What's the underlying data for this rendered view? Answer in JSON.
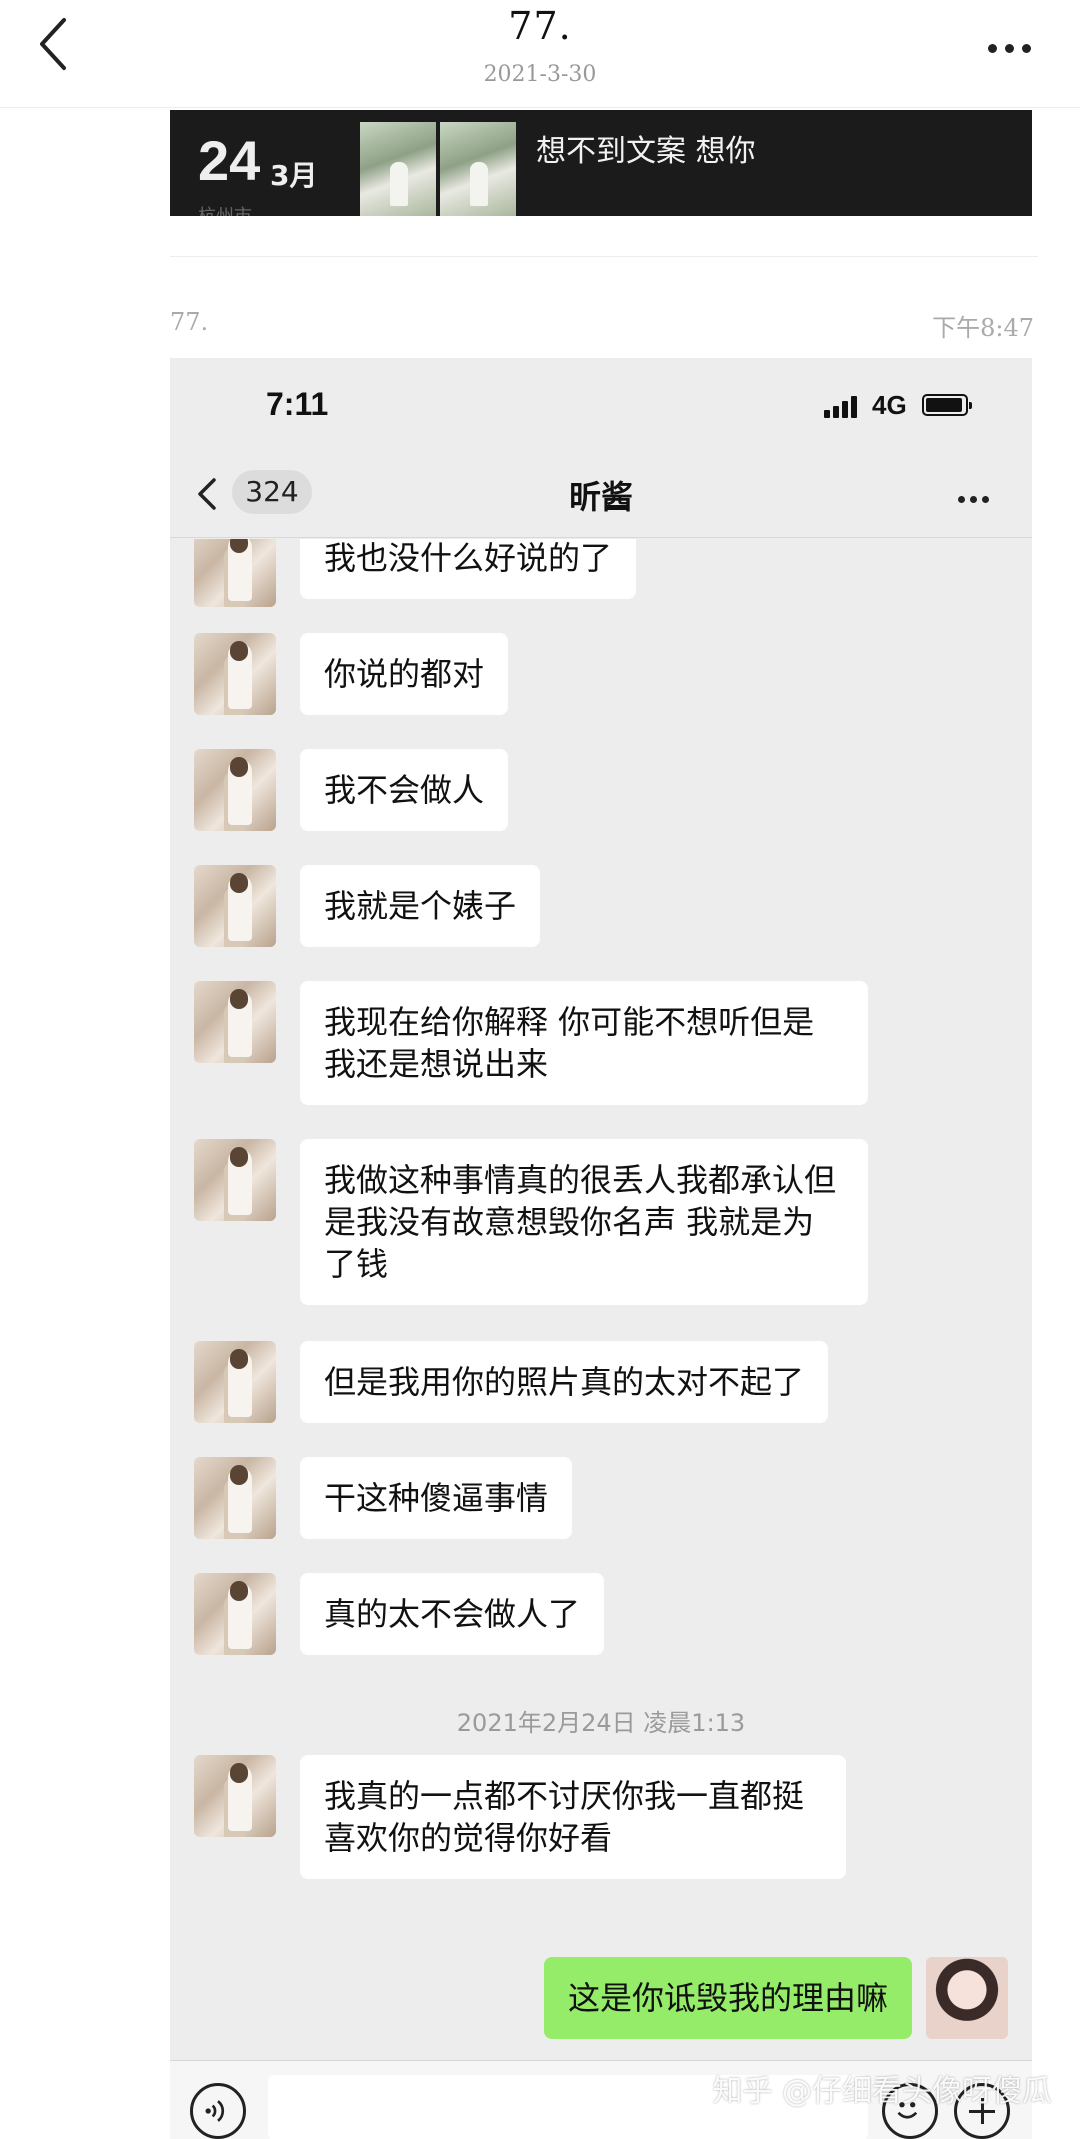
{
  "post": {
    "title": "77.",
    "date": "2021-3-30",
    "author": "77.",
    "time": "下午8:47"
  },
  "banner": {
    "day": "24",
    "month": "3月",
    "city": "杭州市",
    "text": "想不到文案 想你"
  },
  "chat_screenshot": {
    "status_time": "7:11",
    "network": "4G",
    "unread_count": "324",
    "contact_name": "昕酱",
    "messages": [
      {
        "text": "我也没什么好说的了"
      },
      {
        "text": "你说的都对"
      },
      {
        "text": "我不会做人"
      },
      {
        "text": "我就是个婊子"
      },
      {
        "text": "我现在给你解释 你可能不想听但是我还是想说出来"
      },
      {
        "text": "我做这种事情真的很丢人我都承认但是我没有故意想毁你名声 我就是为了钱"
      },
      {
        "text": "但是我用你的照片真的太对不起了"
      },
      {
        "text": "干这种傻逼事情"
      },
      {
        "text": "真的太不会做人了"
      }
    ],
    "timestamp": "2021年2月24日 凌晨1:13",
    "late_message": "我真的一点都不讨厌你我一直都挺喜欢你的觉得你好看",
    "sent_message": "这是你诋毁我的理由嘛"
  },
  "watermark": "知乎 @仔细看头像呀傻瓜",
  "colors": {
    "sent_bubble": "#95ec69",
    "received_bubble": "#ffffff",
    "chat_bg": "#ededed",
    "banner_bg": "#1b1b1b"
  },
  "icons": [
    "back-chevron-icon",
    "more-dots-icon",
    "signal-icon",
    "battery-icon",
    "voice-icon",
    "emoji-icon",
    "plus-icon"
  ]
}
